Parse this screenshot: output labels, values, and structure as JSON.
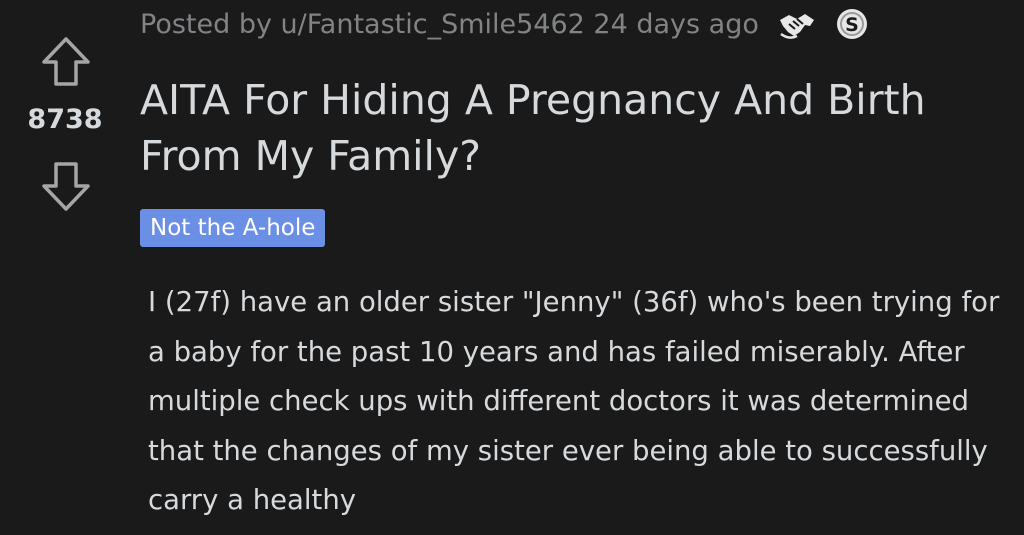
{
  "post": {
    "meta": "Posted by u/Fantastic_Smile5462 24 days ago",
    "score": "8738",
    "title": "AITA For Hiding A Pregnancy And Birth From My Family?",
    "flair": "Not the A-hole",
    "body": "I (27f) have an older sister \"Jenny\" (36f) who's been trying for a baby for the past 10 years and has failed miserably. After multiple check ups with different doctors it was determined that the changes of my sister ever being able to successfully carry a healthy",
    "awards": [
      {
        "icon": "handshake-award-icon"
      },
      {
        "icon": "silver-award-icon",
        "letter": "S"
      }
    ]
  },
  "colors": {
    "background": "#1a1a1b",
    "text": "#d7dadc",
    "meta": "#818384",
    "flair": "#6c8fe6"
  }
}
